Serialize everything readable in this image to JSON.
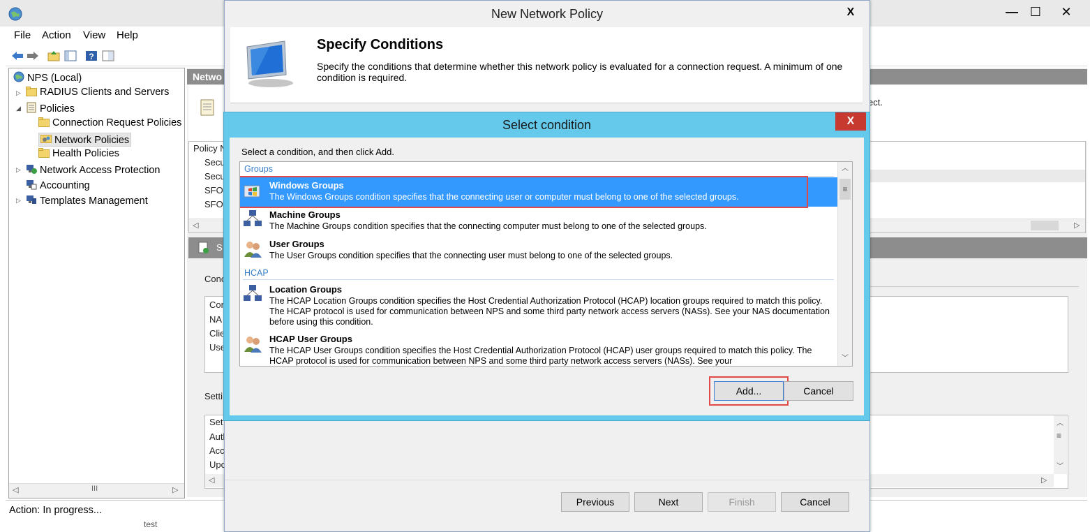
{
  "mmc": {
    "menu": [
      "File",
      "Action",
      "View",
      "Help"
    ],
    "tree": [
      {
        "label": "NPS (Local)",
        "level": 0,
        "icon": "globe-icon",
        "expander": ""
      },
      {
        "label": "RADIUS Clients and Servers",
        "level": 1,
        "icon": "folder-icon",
        "expander": "▷"
      },
      {
        "label": "Policies",
        "level": 1,
        "icon": "policies-icon",
        "expander": "◢"
      },
      {
        "label": "Connection Request Policies",
        "level": 2,
        "icon": "folder-icon",
        "expander": ""
      },
      {
        "label": "Network Policies",
        "level": 2,
        "icon": "network-policy-icon",
        "expander": ""
      },
      {
        "label": "Health Policies",
        "level": 2,
        "icon": "folder-icon",
        "expander": ""
      },
      {
        "label": "Network Access Protection",
        "level": 1,
        "icon": "nap-icon",
        "expander": "▷"
      },
      {
        "label": "Accounting",
        "level": 1,
        "icon": "accounting-icon",
        "expander": ""
      },
      {
        "label": "Templates Management",
        "level": 1,
        "icon": "templates-icon",
        "expander": "▷"
      }
    ],
    "tree_scroll_thumb": "III",
    "status": "Action:  In progress...",
    "right_header": "Netwo",
    "right_snippets": {
      "ect": "ect.",
      "policy_col": "Policy N",
      "rows": [
        "Secu",
        "Secu",
        "SFO",
        "SFO"
      ],
      "cond_label": "Conc",
      "cond_rows": [
        "Cor",
        "NA",
        "Clie",
        "Use"
      ],
      "settings_label": "Setti",
      "settings_rows": [
        "Set",
        "Autl",
        "Acc",
        "Upc"
      ],
      "s_row": "S",
      "bottom_item": "test"
    }
  },
  "wizard": {
    "title": "New Network Policy",
    "close": "X",
    "heading": "Specify Conditions",
    "description": "Specify the conditions that determine whether this network policy is evaluated for a connection request. A minimum of one condition is required.",
    "buttons": {
      "previous": "Previous",
      "next": "Next",
      "finish": "Finish",
      "cancel": "Cancel"
    }
  },
  "dialog": {
    "title": "Select condition",
    "close": "X",
    "instruction": "Select a condition, and then click Add.",
    "groups": [
      {
        "name": "Groups",
        "conditions": [
          {
            "title": "Windows Groups",
            "description": "The Windows Groups condition specifies that the connecting user or computer must belong to one of the selected groups.",
            "selected": true
          },
          {
            "title": "Machine Groups",
            "description": "The Machine Groups condition specifies that the connecting computer must belong to one of the selected groups.",
            "selected": false
          },
          {
            "title": "User Groups",
            "description": "The User Groups condition specifies that the connecting user must belong to one of the selected groups.",
            "selected": false
          }
        ]
      },
      {
        "name": "HCAP",
        "conditions": [
          {
            "title": "Location Groups",
            "description": "The HCAP Location Groups condition specifies the Host Credential Authorization Protocol (HCAP) location groups required to match this policy. The HCAP protocol is used for communication between NPS and some third party network access servers (NASs). See your NAS documentation before using this condition.",
            "selected": false
          },
          {
            "title": "HCAP User Groups",
            "description": "The HCAP User Groups condition specifies the Host Credential Authorization Protocol (HCAP) user groups required to match this policy. The HCAP protocol is used for communication between NPS and some third party network access servers (NASs). See your",
            "selected": false
          }
        ]
      }
    ],
    "buttons": {
      "add": "Add...",
      "cancel": "Cancel"
    }
  },
  "colors": {
    "accent": "#3399ff",
    "dialog_frame": "#64c9ea",
    "close_red": "#c7382f",
    "group_header": "#3a7fc7",
    "highlight_box": "#e24a4a"
  }
}
